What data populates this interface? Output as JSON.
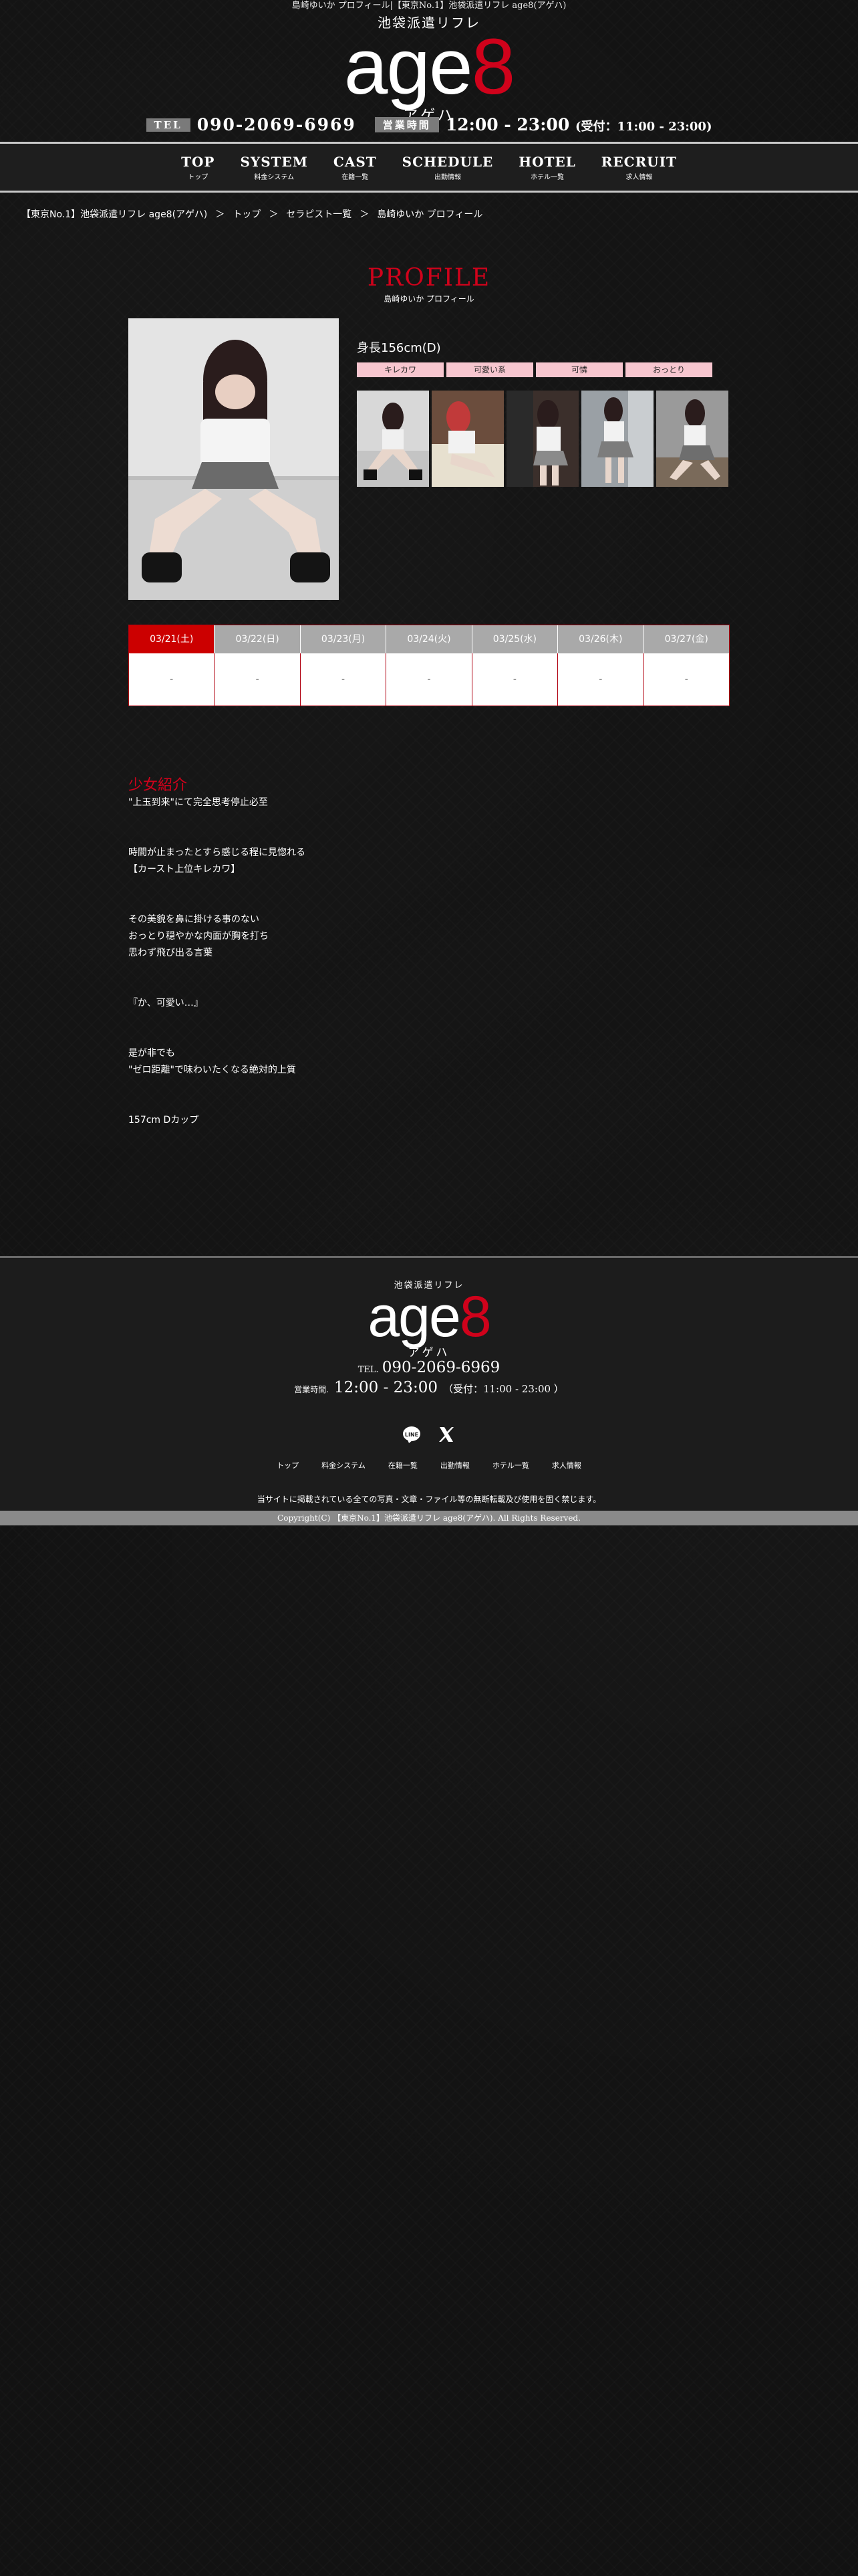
{
  "seo_title": "島崎ゆいか プロフィール|【東京No.1】池袋派遣リフレ age8(アゲハ)",
  "logo": {
    "sub": "池袋派遣リフレ",
    "word_left": "age",
    "word_right": "8",
    "kana": "アゲハ"
  },
  "header": {
    "tel_label": "TEL",
    "tel": "090-2069-6969",
    "hours_label": "営業時間",
    "hours": "12:00 - 23:00",
    "reception": "(受付：11:00 - 23:00)"
  },
  "nav": [
    {
      "en": "TOP",
      "jp": "トップ"
    },
    {
      "en": "SYSTEM",
      "jp": "料金システム"
    },
    {
      "en": "CAST",
      "jp": "在籍一覧"
    },
    {
      "en": "SCHEDULE",
      "jp": "出勤情報"
    },
    {
      "en": "HOTEL",
      "jp": "ホテル一覧"
    },
    {
      "en": "RECRUIT",
      "jp": "求人情報"
    }
  ],
  "breadcrumb": [
    "【東京No.1】池袋派遣リフレ age8(アゲハ)",
    "トップ",
    "セラピスト一覧",
    "島崎ゆいか プロフィール"
  ],
  "breadcrumb_sep": "＞",
  "profile": {
    "heading": "PROFILE",
    "subheading": "島崎ゆいか プロフィール",
    "height": "身長156cm(D)",
    "tags": [
      "キレカワ",
      "可愛い系",
      "可憐",
      "おっとり"
    ]
  },
  "schedule": {
    "dates": [
      "03/21(土)",
      "03/22(日)",
      "03/23(月)",
      "03/24(火)",
      "03/25(水)",
      "03/26(木)",
      "03/27(金)"
    ],
    "active_index": 0,
    "values": [
      "-",
      "-",
      "-",
      "-",
      "-",
      "-",
      "-"
    ]
  },
  "intro": {
    "title": "少女紹介",
    "paragraphs": [
      "\"上玉到来\"にて完全思考停止必至",
      "時間が止まったとすら感じる程に見惚れる\n【カースト上位キレカワ】",
      "その美貌を鼻に掛ける事のない\nおっとり穏やかな内面が胸を打ち\n思わず飛び出る言葉",
      "『か、可愛い…』",
      "是が非でも\n\"ゼロ距離\"で味わいたくなる絶対的上質",
      "157cm Dカップ"
    ]
  },
  "footer": {
    "tel_label": "TEL.",
    "tel": "090-2069-6969",
    "hours_label": "営業時間.",
    "hours": "12:00 - 23:00",
    "reception": "（受付：11:00 - 23:00 ）",
    "links": [
      "トップ",
      "料金システム",
      "在籍一覧",
      "出勤情報",
      "ホテル一覧",
      "求人情報"
    ],
    "notice": "当サイトに掲載されている全ての写真・文章・ファイル等の無断転載及び使用を固く禁じます。",
    "copyright": "Copyright(C) 【東京No.1】池袋派遣リフレ age8(アゲハ). All Rights Reserved.",
    "sns": [
      "line-icon",
      "x-icon"
    ]
  },
  "colors": {
    "accent": "#d0021b",
    "pill": "#f7c6cf",
    "schedule_active": "#cc0000"
  }
}
